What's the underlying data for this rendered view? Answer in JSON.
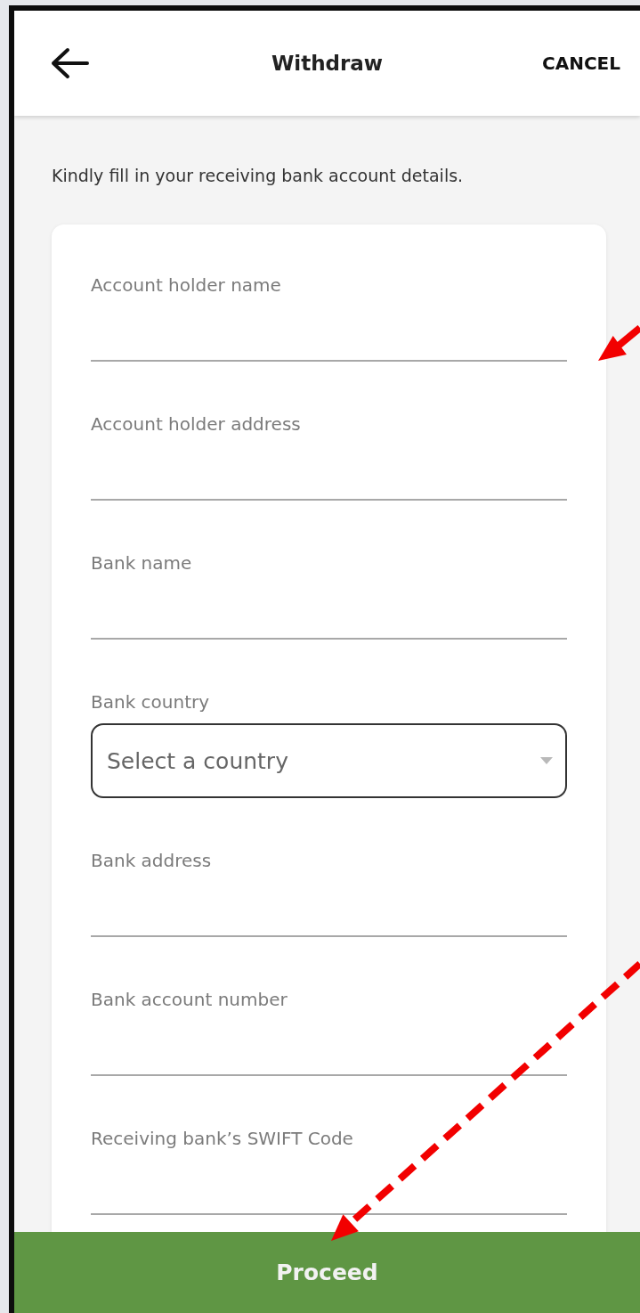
{
  "header": {
    "title": "Withdraw",
    "cancel": "CANCEL"
  },
  "instruction": "Kindly fill in your receiving bank account details.",
  "fields": [
    {
      "kind": "text",
      "label": "Account holder name"
    },
    {
      "kind": "text",
      "label": "Account holder address"
    },
    {
      "kind": "text",
      "label": "Bank name"
    },
    {
      "kind": "select",
      "label": "Bank country",
      "placeholder": "Select a country"
    },
    {
      "kind": "text",
      "label": "Bank address"
    },
    {
      "kind": "text",
      "label": "Bank account number"
    },
    {
      "kind": "text",
      "label": "Receiving bank’s SWIFT Code"
    }
  ],
  "proceed": "Proceed",
  "annotations": [
    {
      "kind": "solid"
    },
    {
      "kind": "dashed"
    }
  ]
}
